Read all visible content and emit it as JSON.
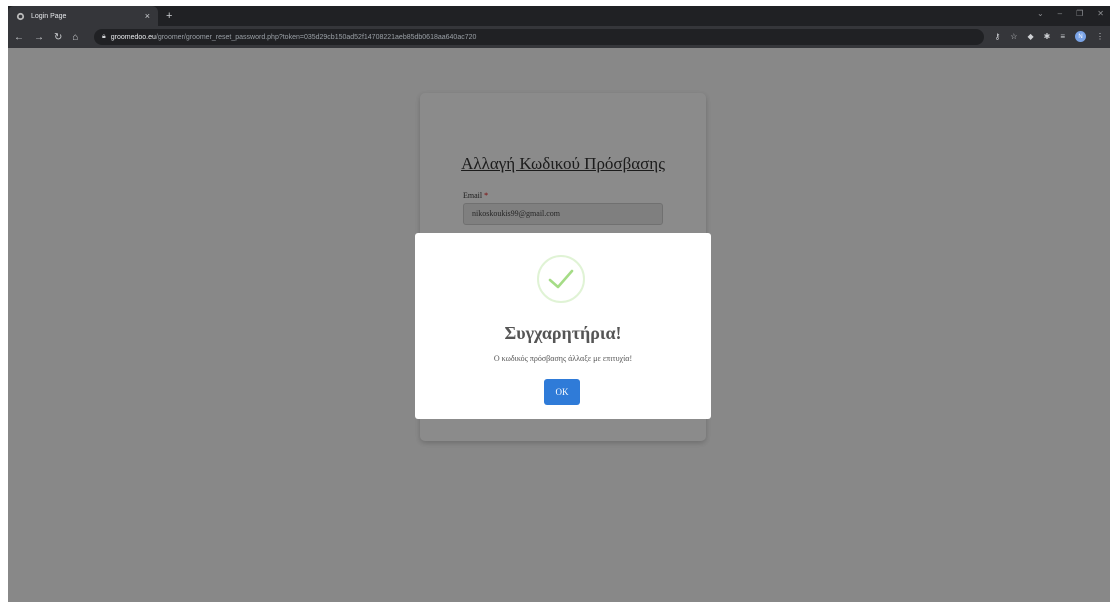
{
  "browser": {
    "tab_title": "Login Page",
    "tab_close": "×",
    "new_tab": "+",
    "url_host": "groomedoo.eu",
    "url_path": "/groomer/groomer_reset_password.php?token=035d29cb150ad52f14708221aeb85db0618aa640ac720",
    "profile_initial": "N"
  },
  "card": {
    "title": "Αλλαγή Κωδικού Πρόσβασης",
    "email_label": "Email",
    "required_mark": "*",
    "email_value": "nikoskoukis99@gmail.com"
  },
  "modal": {
    "title": "Συγχαρητήρια!",
    "message": "Ο κωδικός πρόσβασης άλλαξε με επιτυχία!",
    "ok_label": "OK",
    "icon": "success-check-icon",
    "accent_color": "#a5dc86"
  }
}
